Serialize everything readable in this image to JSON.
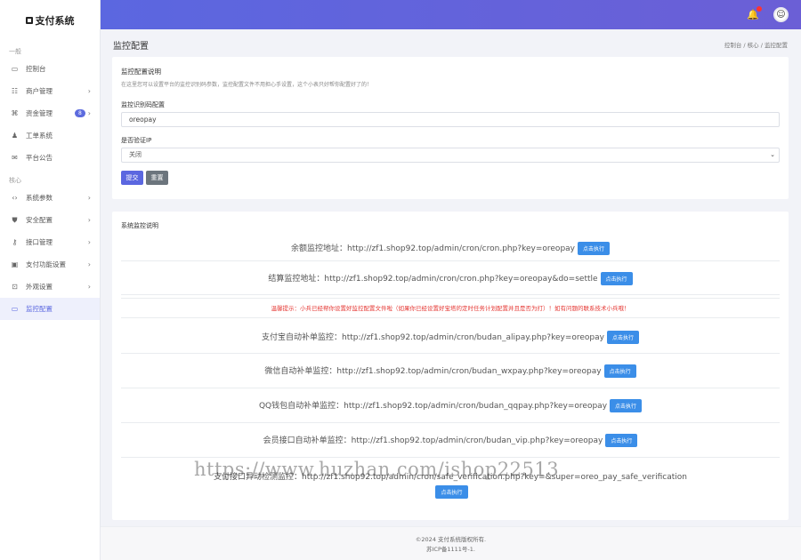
{
  "app": {
    "title": "支付系统"
  },
  "sidebar": {
    "group1": "一般",
    "group2": "核心",
    "items": [
      {
        "label": "控制台",
        "icon": "monitor-icon",
        "glyph": "▭",
        "chevron": false
      },
      {
        "label": "商户管理",
        "icon": "users-icon",
        "glyph": "☷",
        "chevron": true
      },
      {
        "label": "资金管理",
        "icon": "command-icon",
        "glyph": "⌘",
        "chevron": true,
        "badge": "8"
      },
      {
        "label": "工单系统",
        "icon": "user-icon",
        "glyph": "♟",
        "chevron": false
      },
      {
        "label": "平台公告",
        "icon": "mail-icon",
        "glyph": "✉",
        "chevron": false
      },
      {
        "label": "系统参数",
        "icon": "code-icon",
        "glyph": "‹›",
        "chevron": true
      },
      {
        "label": "安全配置",
        "icon": "shield-icon",
        "glyph": "⛊",
        "chevron": true
      },
      {
        "label": "接口管理",
        "icon": "key-icon",
        "glyph": "⚷",
        "chevron": true
      },
      {
        "label": "支付功能设置",
        "icon": "grid-icon",
        "glyph": "▣",
        "chevron": true
      },
      {
        "label": "外观设置",
        "icon": "layout-icon",
        "glyph": "⊡",
        "chevron": true
      },
      {
        "label": "监控配置",
        "icon": "screen-icon",
        "glyph": "▭",
        "chevron": false,
        "active": true
      }
    ]
  },
  "topbar": {
    "notification_count": "3"
  },
  "page": {
    "title": "监控配置",
    "breadcrumb": "控制台 / 核心 / 监控配置"
  },
  "config": {
    "title": "监控配置说明",
    "desc": "在这里您可以设置平台的监控识别码参数，监控配置文件不用担心手设置，这个小表只好帮你配置好了的！",
    "field1_label": "监控识别码配置",
    "field1_value": "oreopay",
    "field2_label": "是否验证IP",
    "field2_value": "关闭",
    "submit": "提交",
    "reset": "重置"
  },
  "monitor": {
    "title": "系统监控说明",
    "exec_label": "点击执行",
    "warning": "温馨提示：小兵已经帮你设置好监控配置文件啦（如果你已经设置好宝塔的定时任务计划配置并且是否为打）！如有问题的联系技术小兵哦！",
    "rows": [
      "余额监控地址：http://zf1.shop92.top/admin/cron/cron.php?key=oreopay",
      "结算监控地址：http://zf1.shop92.top/admin/cron/cron.php?key=oreopay&do=settle",
      "支付宝自动补单监控：http://zf1.shop92.top/admin/cron/budan_alipay.php?key=oreopay",
      "微信自动补单监控：http://zf1.shop92.top/admin/cron/budan_wxpay.php?key=oreopay",
      "QQ钱包自动补单监控：http://zf1.shop92.top/admin/cron/budan_qqpay.php?key=oreopay",
      "会员接口自动补单监控：http://zf1.shop92.top/admin/cron/budan_vip.php?key=oreopay",
      "支付接口异动检测监控：http://zf1.shop92.top/admin/cron/safe_verification.php?key=&super=oreo_pay_safe_verification"
    ]
  },
  "watermark": "https://www.huzhan.com/ishop22513",
  "footer": {
    "line1": "©2024 支付系统版权所有.",
    "line2": "苏ICP备1111号-1."
  },
  "colors": {
    "accent": "#5b67e0",
    "exec_button": "#3b8ee8",
    "warning": "#e53935",
    "reset_button": "#6c757d"
  }
}
